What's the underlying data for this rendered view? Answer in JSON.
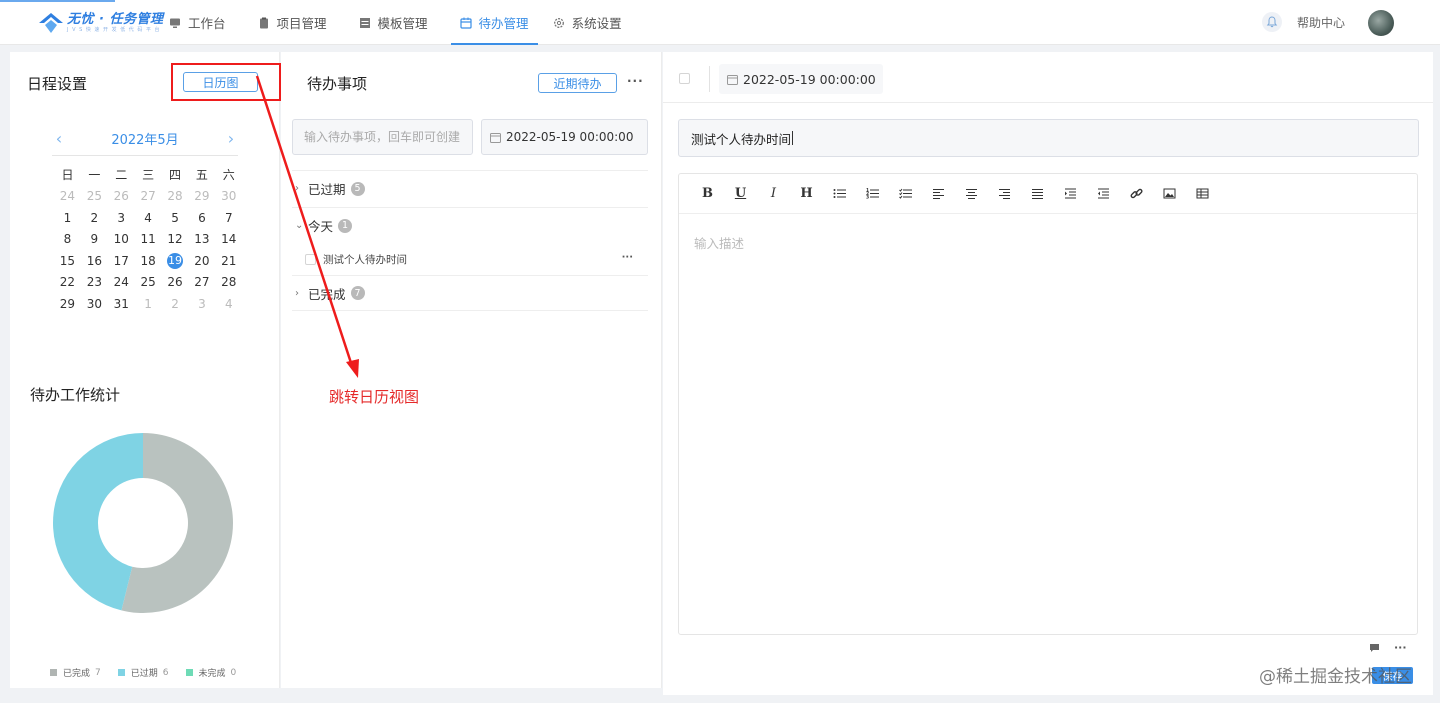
{
  "app": {
    "logo_title": "无忧 · 任务管理",
    "logo_subtitle": "J V S 快 速 开 发 低 代 码 平 台"
  },
  "nav": {
    "items": [
      {
        "label": "工作台",
        "icon": "monitor-icon",
        "active": false
      },
      {
        "label": "项目管理",
        "icon": "clipboard-icon",
        "active": false
      },
      {
        "label": "模板管理",
        "icon": "template-icon",
        "active": false
      },
      {
        "label": "待办管理",
        "icon": "calendar-icon",
        "active": true
      },
      {
        "label": "系统设置",
        "icon": "gear-icon",
        "active": false
      }
    ],
    "help": "帮助中心"
  },
  "schedule": {
    "title": "日程设置",
    "calendar_button": "日历图",
    "month_title": "2022年5月",
    "prev": "‹",
    "next": "›",
    "weekdays": [
      "日",
      "一",
      "二",
      "三",
      "四",
      "五",
      "六"
    ],
    "days": [
      {
        "d": "24",
        "muted": true
      },
      {
        "d": "25",
        "muted": true
      },
      {
        "d": "26",
        "muted": true
      },
      {
        "d": "27",
        "muted": true
      },
      {
        "d": "28",
        "muted": true
      },
      {
        "d": "29",
        "muted": true
      },
      {
        "d": "30",
        "muted": true
      },
      {
        "d": "1"
      },
      {
        "d": "2"
      },
      {
        "d": "3"
      },
      {
        "d": "4"
      },
      {
        "d": "5"
      },
      {
        "d": "6"
      },
      {
        "d": "7"
      },
      {
        "d": "8"
      },
      {
        "d": "9"
      },
      {
        "d": "10"
      },
      {
        "d": "11"
      },
      {
        "d": "12"
      },
      {
        "d": "13"
      },
      {
        "d": "14"
      },
      {
        "d": "15"
      },
      {
        "d": "16"
      },
      {
        "d": "17"
      },
      {
        "d": "18"
      },
      {
        "d": "19",
        "today": true
      },
      {
        "d": "20"
      },
      {
        "d": "21"
      },
      {
        "d": "22"
      },
      {
        "d": "23"
      },
      {
        "d": "24"
      },
      {
        "d": "25"
      },
      {
        "d": "26"
      },
      {
        "d": "27"
      },
      {
        "d": "28"
      },
      {
        "d": "29"
      },
      {
        "d": "30"
      },
      {
        "d": "31"
      },
      {
        "d": "1",
        "muted": true
      },
      {
        "d": "2",
        "muted": true
      },
      {
        "d": "3",
        "muted": true
      },
      {
        "d": "4",
        "muted": true
      }
    ]
  },
  "stats": {
    "title": "待办工作统计"
  },
  "chart_data": {
    "type": "pie",
    "donut": true,
    "categories": [
      "已完成",
      "已过期",
      "未完成"
    ],
    "values": [
      7,
      6,
      0
    ],
    "colors": [
      "#b9c2bf",
      "#7fd3e4",
      "#6edbb6"
    ],
    "legend_position": "bottom"
  },
  "todos": {
    "title": "待办事项",
    "recent_button": "近期待办",
    "more": "···",
    "input_placeholder": "输入待办事项，回车即可创建",
    "date_value": "2022-05-19 00:00:00",
    "groups": [
      {
        "label": "已过期",
        "count": "5",
        "expanded": false
      },
      {
        "label": "今天",
        "count": "1",
        "expanded": true
      },
      {
        "label": "已完成",
        "count": "7",
        "expanded": false
      }
    ],
    "today_items": [
      {
        "label": "测试个人待办时间"
      }
    ]
  },
  "detail": {
    "date_value": "2022-05-19 00:00:00",
    "title_value": "测试个人待办时间",
    "description_placeholder": "输入描述",
    "save_label": "保存",
    "toolbar": [
      "bold-icon",
      "underline-icon",
      "italic-icon",
      "heading-icon",
      "bullet-list-icon",
      "ordered-list-icon",
      "checklist-icon",
      "align-left-icon",
      "align-center-icon",
      "align-right-icon",
      "align-justify-icon",
      "indent-icon",
      "outdent-icon",
      "link-icon",
      "image-icon",
      "table-icon"
    ]
  },
  "annotation": {
    "text": "跳转日历视图",
    "color": "#e52a2a"
  },
  "watermark": "@稀土掘金技术社区"
}
